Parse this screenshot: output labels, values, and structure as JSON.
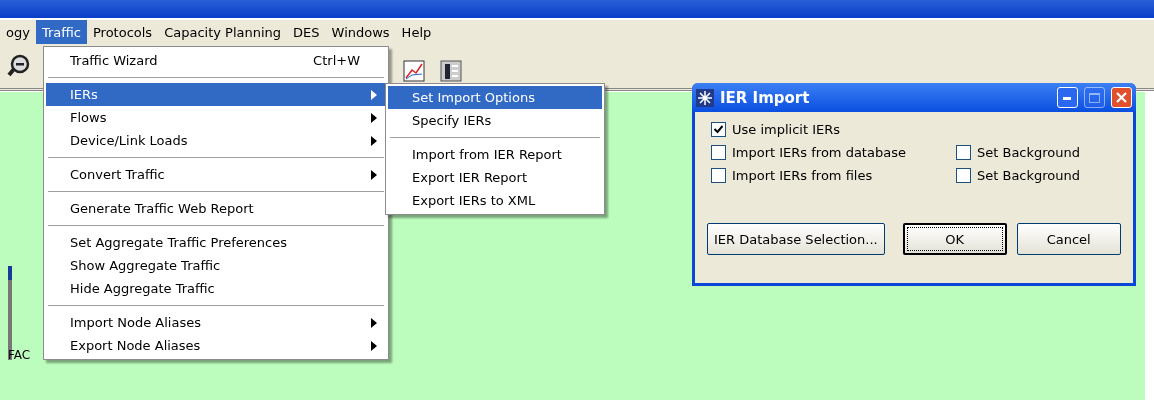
{
  "menubar": [
    {
      "label": "ogy",
      "selected": false
    },
    {
      "label": "Traffic",
      "selected": true
    },
    {
      "label": "Protocols",
      "selected": false
    },
    {
      "label": "Capacity Planning",
      "selected": false
    },
    {
      "label": "DES",
      "selected": false
    },
    {
      "label": "Windows",
      "selected": false
    },
    {
      "label": "Help",
      "selected": false
    }
  ],
  "canvas": {
    "node_label": "FAC"
  },
  "traffic_menu": [
    {
      "kind": "item",
      "label": "Traffic Wizard",
      "shortcut": "Ctrl+W",
      "submenu": false,
      "selected": false
    },
    {
      "kind": "separator"
    },
    {
      "kind": "item",
      "label": "IERs",
      "submenu": true,
      "selected": true
    },
    {
      "kind": "item",
      "label": "Flows",
      "submenu": true,
      "selected": false
    },
    {
      "kind": "item",
      "label": "Device/Link Loads",
      "submenu": true,
      "selected": false
    },
    {
      "kind": "separator"
    },
    {
      "kind": "item",
      "label": "Convert Traffic",
      "submenu": true,
      "selected": false
    },
    {
      "kind": "separator"
    },
    {
      "kind": "item",
      "label": "Generate Traffic Web Report",
      "submenu": false,
      "selected": false
    },
    {
      "kind": "separator"
    },
    {
      "kind": "item",
      "label": "Set Aggregate Traffic Preferences",
      "submenu": false,
      "selected": false
    },
    {
      "kind": "item",
      "label": "Show Aggregate Traffic",
      "submenu": false,
      "selected": false
    },
    {
      "kind": "item",
      "label": "Hide Aggregate Traffic",
      "submenu": false,
      "selected": false
    },
    {
      "kind": "separator"
    },
    {
      "kind": "item",
      "label": "Import Node Aliases",
      "submenu": true,
      "selected": false
    },
    {
      "kind": "item",
      "label": "Export Node Aliases",
      "submenu": true,
      "selected": false
    }
  ],
  "iers_submenu": [
    {
      "kind": "item",
      "label": "Set Import Options",
      "submenu": false,
      "selected": true
    },
    {
      "kind": "item",
      "label": "Specify IERs",
      "submenu": false,
      "selected": false
    },
    {
      "kind": "separator"
    },
    {
      "kind": "item",
      "label": "Import from IER Report",
      "submenu": false,
      "selected": false
    },
    {
      "kind": "item",
      "label": "Export IER Report",
      "submenu": false,
      "selected": false
    },
    {
      "kind": "item",
      "label": "Export IERs to XML",
      "submenu": false,
      "selected": false
    }
  ],
  "dialog": {
    "title": "IER Import",
    "options": [
      {
        "label": "Use implicit IERs",
        "checked": true
      },
      {
        "label": "Import IERs from database",
        "checked": false
      },
      {
        "label": "Set Background",
        "checked": false
      },
      {
        "label": "Import IERs from files",
        "checked": false
      },
      {
        "label": "Set Background",
        "checked": false
      }
    ],
    "buttons": [
      {
        "label": "IER Database Selection...",
        "default": false
      },
      {
        "label": "OK",
        "default": true
      },
      {
        "label": "Cancel",
        "default": false
      }
    ]
  }
}
